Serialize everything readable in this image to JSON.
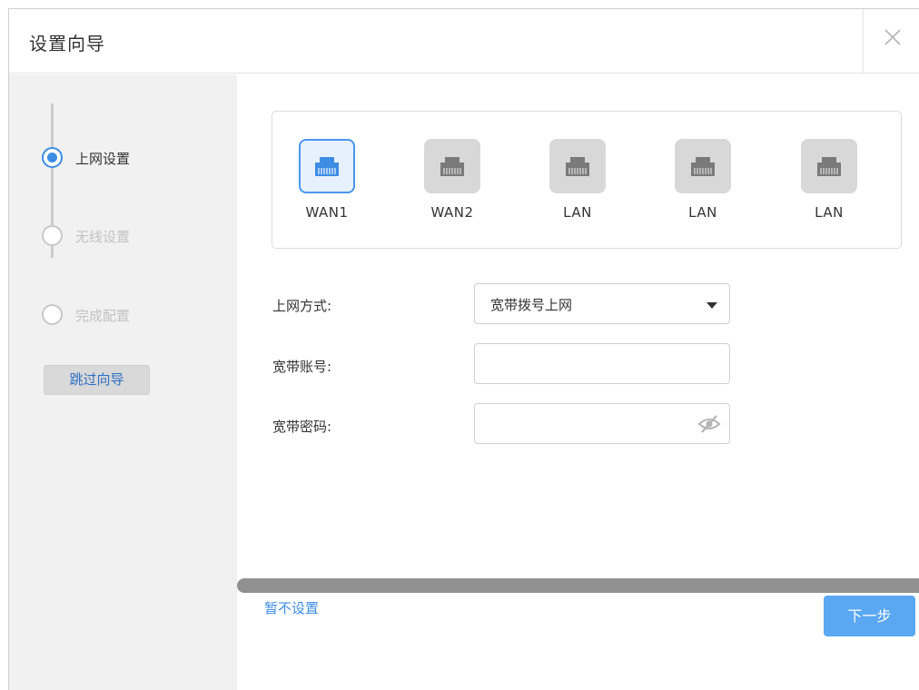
{
  "dialog": {
    "title": "设置向导"
  },
  "steps": [
    {
      "label": "上网设置",
      "active": true
    },
    {
      "label": "无线设置",
      "active": false
    },
    {
      "label": "完成配置",
      "active": false
    }
  ],
  "sidebar": {
    "skip_label": "跳过向导"
  },
  "ports": [
    {
      "label": "WAN1",
      "selected": true
    },
    {
      "label": "WAN2",
      "selected": false
    },
    {
      "label": "LAN",
      "selected": false
    },
    {
      "label": "LAN",
      "selected": false
    },
    {
      "label": "LAN",
      "selected": false
    }
  ],
  "form": {
    "mode_label": "上网方式:",
    "mode_value": "宽带拨号上网",
    "account_label": "宽带账号:",
    "account_value": "",
    "password_label": "宽带密码:",
    "password_value": ""
  },
  "footer": {
    "later_label": "暂不设置",
    "next_label": "下一步"
  },
  "colors": {
    "accent": "#3d8de4",
    "primary_button": "#5aa7f2",
    "sidebar_bg": "#f1f1f1"
  }
}
